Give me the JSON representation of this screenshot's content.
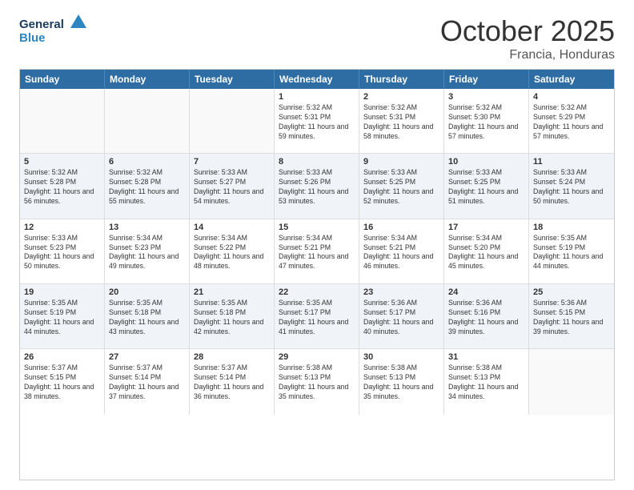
{
  "header": {
    "logo_general": "General",
    "logo_blue": "Blue",
    "month": "October 2025",
    "location": "Francia, Honduras"
  },
  "days": [
    "Sunday",
    "Monday",
    "Tuesday",
    "Wednesday",
    "Thursday",
    "Friday",
    "Saturday"
  ],
  "weeks": [
    [
      {
        "num": "",
        "sunrise": "",
        "sunset": "",
        "daylight": ""
      },
      {
        "num": "",
        "sunrise": "",
        "sunset": "",
        "daylight": ""
      },
      {
        "num": "",
        "sunrise": "",
        "sunset": "",
        "daylight": ""
      },
      {
        "num": "1",
        "sunrise": "Sunrise: 5:32 AM",
        "sunset": "Sunset: 5:31 PM",
        "daylight": "Daylight: 11 hours and 59 minutes."
      },
      {
        "num": "2",
        "sunrise": "Sunrise: 5:32 AM",
        "sunset": "Sunset: 5:31 PM",
        "daylight": "Daylight: 11 hours and 58 minutes."
      },
      {
        "num": "3",
        "sunrise": "Sunrise: 5:32 AM",
        "sunset": "Sunset: 5:30 PM",
        "daylight": "Daylight: 11 hours and 57 minutes."
      },
      {
        "num": "4",
        "sunrise": "Sunrise: 5:32 AM",
        "sunset": "Sunset: 5:29 PM",
        "daylight": "Daylight: 11 hours and 57 minutes."
      }
    ],
    [
      {
        "num": "5",
        "sunrise": "Sunrise: 5:32 AM",
        "sunset": "Sunset: 5:28 PM",
        "daylight": "Daylight: 11 hours and 56 minutes."
      },
      {
        "num": "6",
        "sunrise": "Sunrise: 5:32 AM",
        "sunset": "Sunset: 5:28 PM",
        "daylight": "Daylight: 11 hours and 55 minutes."
      },
      {
        "num": "7",
        "sunrise": "Sunrise: 5:33 AM",
        "sunset": "Sunset: 5:27 PM",
        "daylight": "Daylight: 11 hours and 54 minutes."
      },
      {
        "num": "8",
        "sunrise": "Sunrise: 5:33 AM",
        "sunset": "Sunset: 5:26 PM",
        "daylight": "Daylight: 11 hours and 53 minutes."
      },
      {
        "num": "9",
        "sunrise": "Sunrise: 5:33 AM",
        "sunset": "Sunset: 5:25 PM",
        "daylight": "Daylight: 11 hours and 52 minutes."
      },
      {
        "num": "10",
        "sunrise": "Sunrise: 5:33 AM",
        "sunset": "Sunset: 5:25 PM",
        "daylight": "Daylight: 11 hours and 51 minutes."
      },
      {
        "num": "11",
        "sunrise": "Sunrise: 5:33 AM",
        "sunset": "Sunset: 5:24 PM",
        "daylight": "Daylight: 11 hours and 50 minutes."
      }
    ],
    [
      {
        "num": "12",
        "sunrise": "Sunrise: 5:33 AM",
        "sunset": "Sunset: 5:23 PM",
        "daylight": "Daylight: 11 hours and 50 minutes."
      },
      {
        "num": "13",
        "sunrise": "Sunrise: 5:34 AM",
        "sunset": "Sunset: 5:23 PM",
        "daylight": "Daylight: 11 hours and 49 minutes."
      },
      {
        "num": "14",
        "sunrise": "Sunrise: 5:34 AM",
        "sunset": "Sunset: 5:22 PM",
        "daylight": "Daylight: 11 hours and 48 minutes."
      },
      {
        "num": "15",
        "sunrise": "Sunrise: 5:34 AM",
        "sunset": "Sunset: 5:21 PM",
        "daylight": "Daylight: 11 hours and 47 minutes."
      },
      {
        "num": "16",
        "sunrise": "Sunrise: 5:34 AM",
        "sunset": "Sunset: 5:21 PM",
        "daylight": "Daylight: 11 hours and 46 minutes."
      },
      {
        "num": "17",
        "sunrise": "Sunrise: 5:34 AM",
        "sunset": "Sunset: 5:20 PM",
        "daylight": "Daylight: 11 hours and 45 minutes."
      },
      {
        "num": "18",
        "sunrise": "Sunrise: 5:35 AM",
        "sunset": "Sunset: 5:19 PM",
        "daylight": "Daylight: 11 hours and 44 minutes."
      }
    ],
    [
      {
        "num": "19",
        "sunrise": "Sunrise: 5:35 AM",
        "sunset": "Sunset: 5:19 PM",
        "daylight": "Daylight: 11 hours and 44 minutes."
      },
      {
        "num": "20",
        "sunrise": "Sunrise: 5:35 AM",
        "sunset": "Sunset: 5:18 PM",
        "daylight": "Daylight: 11 hours and 43 minutes."
      },
      {
        "num": "21",
        "sunrise": "Sunrise: 5:35 AM",
        "sunset": "Sunset: 5:18 PM",
        "daylight": "Daylight: 11 hours and 42 minutes."
      },
      {
        "num": "22",
        "sunrise": "Sunrise: 5:35 AM",
        "sunset": "Sunset: 5:17 PM",
        "daylight": "Daylight: 11 hours and 41 minutes."
      },
      {
        "num": "23",
        "sunrise": "Sunrise: 5:36 AM",
        "sunset": "Sunset: 5:17 PM",
        "daylight": "Daylight: 11 hours and 40 minutes."
      },
      {
        "num": "24",
        "sunrise": "Sunrise: 5:36 AM",
        "sunset": "Sunset: 5:16 PM",
        "daylight": "Daylight: 11 hours and 39 minutes."
      },
      {
        "num": "25",
        "sunrise": "Sunrise: 5:36 AM",
        "sunset": "Sunset: 5:15 PM",
        "daylight": "Daylight: 11 hours and 39 minutes."
      }
    ],
    [
      {
        "num": "26",
        "sunrise": "Sunrise: 5:37 AM",
        "sunset": "Sunset: 5:15 PM",
        "daylight": "Daylight: 11 hours and 38 minutes."
      },
      {
        "num": "27",
        "sunrise": "Sunrise: 5:37 AM",
        "sunset": "Sunset: 5:14 PM",
        "daylight": "Daylight: 11 hours and 37 minutes."
      },
      {
        "num": "28",
        "sunrise": "Sunrise: 5:37 AM",
        "sunset": "Sunset: 5:14 PM",
        "daylight": "Daylight: 11 hours and 36 minutes."
      },
      {
        "num": "29",
        "sunrise": "Sunrise: 5:38 AM",
        "sunset": "Sunset: 5:13 PM",
        "daylight": "Daylight: 11 hours and 35 minutes."
      },
      {
        "num": "30",
        "sunrise": "Sunrise: 5:38 AM",
        "sunset": "Sunset: 5:13 PM",
        "daylight": "Daylight: 11 hours and 35 minutes."
      },
      {
        "num": "31",
        "sunrise": "Sunrise: 5:38 AM",
        "sunset": "Sunset: 5:13 PM",
        "daylight": "Daylight: 11 hours and 34 minutes."
      },
      {
        "num": "",
        "sunrise": "",
        "sunset": "",
        "daylight": ""
      }
    ]
  ]
}
